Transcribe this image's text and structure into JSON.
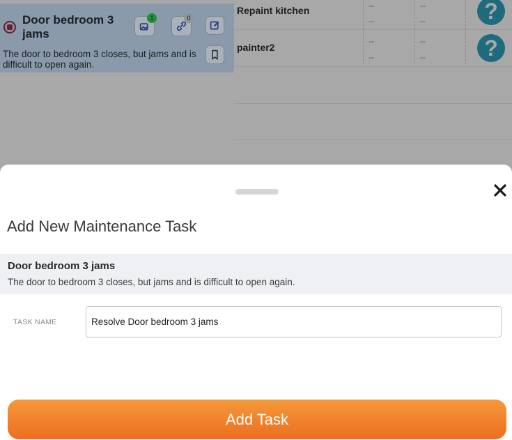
{
  "background": {
    "issue_card": {
      "title": "Door bedroom 3 jams",
      "description": "The door to bedroom 3 closes, but jams and is difficult to open again.",
      "photos_count": "1",
      "links_count": "0",
      "status_icon": "stop-circle-icon",
      "photos_icon": "photos-icon",
      "link_icon": "link-icon",
      "edit_icon": "edit-icon",
      "bookmark_icon": "bookmark-icon",
      "colors": {
        "card_bg": "#8a9aab",
        "status": "#6b1f26",
        "badge_green": "#1f8f3a"
      }
    },
    "task_rows": [
      {
        "name": "Repaint kitchen",
        "col1": "--",
        "col1b": "--",
        "col2": "--",
        "col2b": "--",
        "help": "?"
      },
      {
        "name": "painter2",
        "col1": "--",
        "col1b": "--",
        "col2": "--",
        "col2b": "--",
        "help": "?"
      }
    ]
  },
  "sheet": {
    "title": "Add New Maintenance Task",
    "close_icon": "close-icon",
    "issue": {
      "title": "Door bedroom 3 jams",
      "description": "The door to bedroom 3 closes, but jams and is difficult to open again."
    },
    "task_name_label": "TASK NAME",
    "task_name_value": "Resolve Door bedroom 3 jams",
    "add_button_label": "Add Task",
    "colors": {
      "accent_start": "#f59a3a",
      "accent_end": "#ec6e1f"
    }
  }
}
